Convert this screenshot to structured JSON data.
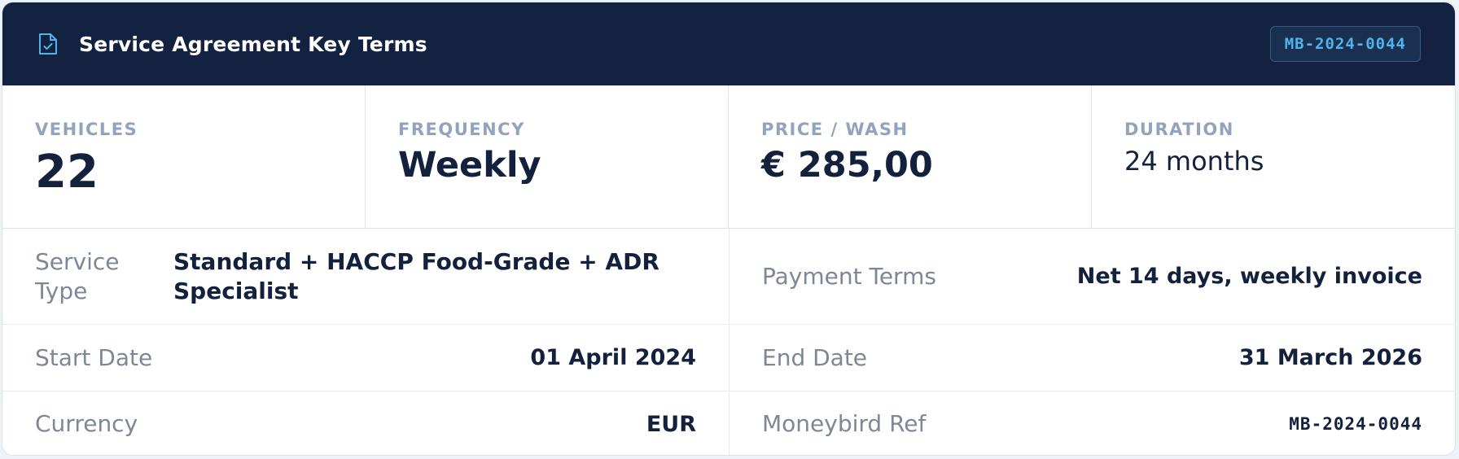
{
  "header": {
    "icon": "document-check-icon",
    "title": "Service Agreement Key Terms",
    "reference": "MB-2024-0044",
    "colors": {
      "background": "#132240",
      "accent": "#4fb3ee"
    }
  },
  "stats": [
    {
      "label": "VEHICLES",
      "value": "22"
    },
    {
      "label": "FREQUENCY",
      "value": "Weekly"
    },
    {
      "label": "PRICE / WASH",
      "value": "€ 285,00"
    },
    {
      "label": "DURATION",
      "value": "24 months"
    }
  ],
  "details": {
    "service_type": {
      "label": "Service Type",
      "value": "Standard + HACCP Food-Grade + ADR Specialist"
    },
    "payment_terms": {
      "label": "Payment Terms",
      "value": "Net 14 days, weekly invoice"
    },
    "start_date": {
      "label": "Start Date",
      "value": "01 April 2024"
    },
    "end_date": {
      "label": "End Date",
      "value": "31 March 2026"
    },
    "currency": {
      "label": "Currency",
      "value": "EUR"
    },
    "moneybird_ref": {
      "label": "Moneybird Ref",
      "value": "MB-2024-0044"
    }
  }
}
